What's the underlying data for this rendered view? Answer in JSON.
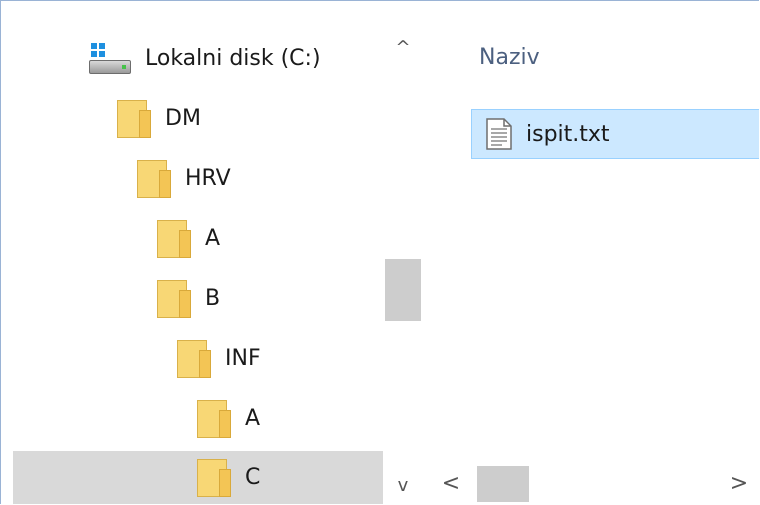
{
  "nav": {
    "items": [
      {
        "label": "Lokalni disk (C:)",
        "icon": "drive-icon",
        "level": 0,
        "selected": false
      },
      {
        "label": "DM",
        "icon": "folder-icon",
        "level": 1,
        "selected": false
      },
      {
        "label": "HRV",
        "icon": "folder-icon",
        "level": 2,
        "selected": false
      },
      {
        "label": "A",
        "icon": "folder-icon",
        "level": 3,
        "selected": false
      },
      {
        "label": "B",
        "icon": "folder-icon",
        "level": 3,
        "selected": false
      },
      {
        "label": "INF",
        "icon": "folder-icon",
        "level": 4,
        "selected": false
      },
      {
        "label": "A",
        "icon": "folder-icon",
        "level": 5,
        "selected": false
      },
      {
        "label": "C",
        "icon": "folder-icon",
        "level": 5,
        "selected": true
      }
    ],
    "scroll_up_glyph": "^",
    "scroll_down_glyph": "v"
  },
  "content": {
    "column_header": "Naziv",
    "files": [
      {
        "name": "ispit.txt",
        "icon": "text-file-icon",
        "selected": true
      }
    ],
    "scroll_left_glyph": "<",
    "scroll_right_glyph": ">"
  },
  "colors": {
    "selection_bg": "#cce8ff",
    "selection_border": "#99d1ff",
    "nav_selected_bg": "#d9d9d9",
    "folder": "#f8d775",
    "header_text": "#4c6080"
  }
}
